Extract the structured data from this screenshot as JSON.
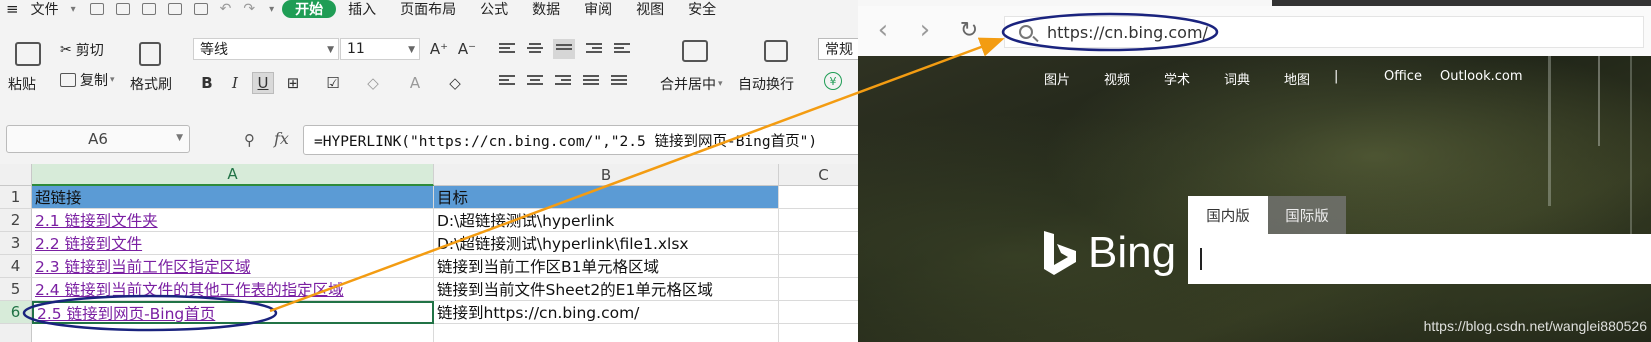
{
  "spreadsheet": {
    "menu": {
      "file": "文件",
      "start": "开始",
      "insert": "插入",
      "page_layout": "页面布局",
      "formula": "公式",
      "data": "数据",
      "review": "审阅",
      "view": "视图",
      "security": "安全"
    },
    "ribbon": {
      "paste": "粘贴",
      "cut": "剪切",
      "copy": "复制",
      "format_painter": "格式刷",
      "font_name": "等线",
      "font_size": "11",
      "merge_center": "合并居中",
      "wrap_text": "自动换行",
      "number_format": "常规"
    },
    "formula_bar": {
      "name_box": "A6",
      "fx": "fx",
      "formula": "=HYPERLINK(\"https://cn.bing.com/\",\"2.5 链接到网页-Bing首页\")"
    },
    "columns": [
      "A",
      "B",
      "C"
    ],
    "rows": [
      {
        "num": "1",
        "a": "超链接",
        "b": "目标"
      },
      {
        "num": "2",
        "a": "2.1 链接到文件夹",
        "b": "D:\\超链接测试\\hyperlink"
      },
      {
        "num": "3",
        "a": "2.2 链接到文件",
        "b": "D:\\超链接测试\\hyperlink\\file1.xlsx"
      },
      {
        "num": "4",
        "a": "2.3 链接到当前工作区指定区域",
        "b": "链接到当前工作区B1单元格区域"
      },
      {
        "num": "5",
        "a": "2.4 链接到当前文件的其他工作表的指定区域",
        "b": "链接到当前文件Sheet2的E1单元格区域"
      },
      {
        "num": "6",
        "a": "2.5 链接到网页-Bing首页",
        "b": "链接到https://cn.bing.com/"
      }
    ],
    "colors": {
      "header_fill": "#5b9bd5",
      "link": "#7a1fa2",
      "active_border": "#217346",
      "start_tab": "#1f9d55"
    }
  },
  "browser": {
    "address": "https://cn.bing.com/",
    "topnav": [
      "图片",
      "视频",
      "学术",
      "词典",
      "地图",
      "|",
      "Office",
      "Outlook.com"
    ],
    "logo_text": "Bing",
    "search_tabs": [
      "国内版",
      "国际版"
    ],
    "watermark": "https://blog.csdn.net/wanglei880526"
  },
  "annotation": {
    "arrow_color": "#f39c12",
    "ellipse_color": "#1a237e"
  }
}
